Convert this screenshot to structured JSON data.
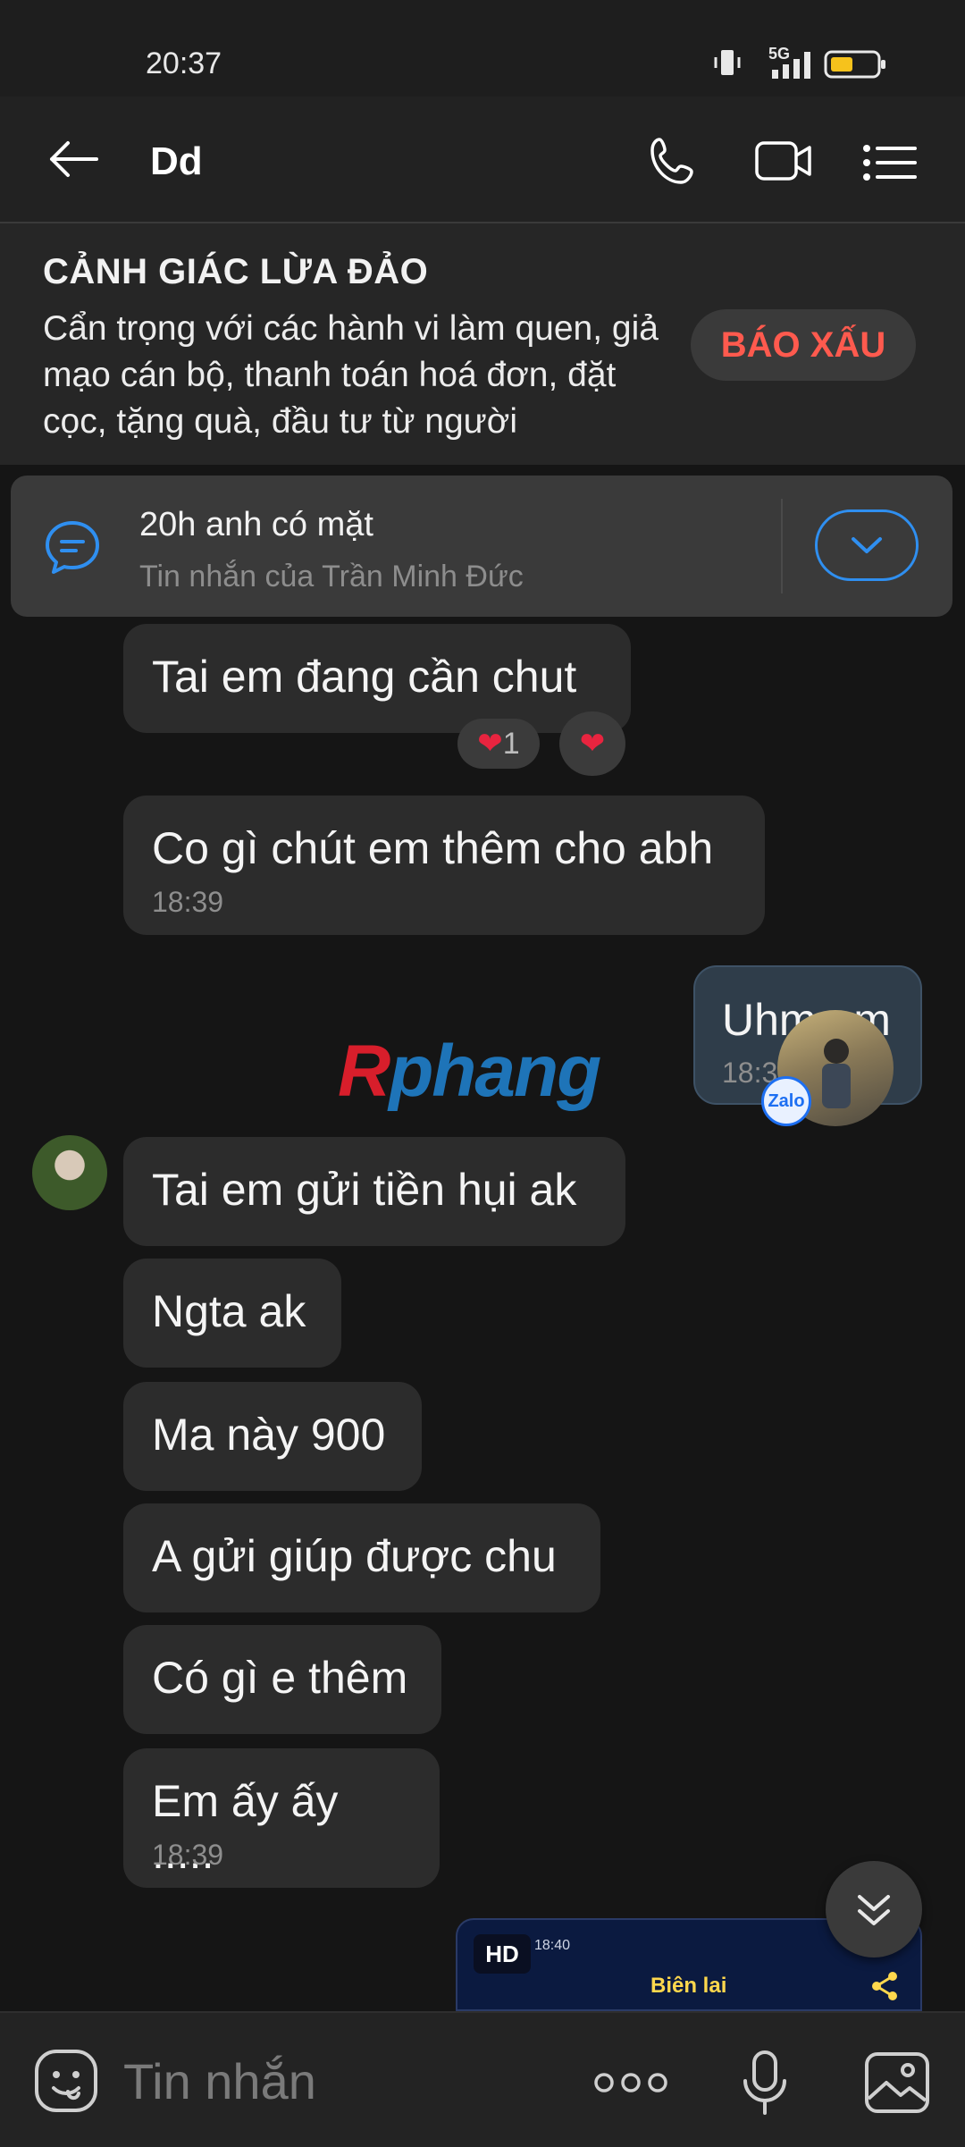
{
  "status_bar": {
    "time": "20:37",
    "network": "5G",
    "icons": [
      "vibrate-icon",
      "signal-icon",
      "battery-icon"
    ]
  },
  "header": {
    "title": "Dd",
    "icons": [
      "back-arrow-icon",
      "phone-icon",
      "video-icon",
      "menu-icon"
    ]
  },
  "warning": {
    "title": "CẢNH GIÁC LỪA ĐẢO",
    "body": "Cẩn trọng với các hành vi làm quen, giả mạo cán bộ, thanh toán hoá đơn, đặt cọc, tặng quà, đầu tư từ người",
    "report_label": "BÁO XẤU"
  },
  "pinned": {
    "title": "20h anh có mặt",
    "subtitle": "Tin nhắn của Trần Minh Đức"
  },
  "messages": [
    {
      "text": "Tai em đang cần chut",
      "reaction_count": "1"
    },
    {
      "text": "Co gì chút em thêm cho abh",
      "time": "18:39"
    },
    {
      "text": "Tai em gửi tiền hụi ak"
    },
    {
      "text": "Ngta ak"
    },
    {
      "text": "Ma này 900"
    },
    {
      "text": "A gửi giúp được chu"
    },
    {
      "text": "Có gì e thêm"
    },
    {
      "text": "Em ấy ấy .....",
      "time": "18:39"
    }
  ],
  "outgoing": {
    "text": "Uhm em",
    "time": "18:3"
  },
  "watermark": {
    "part1": "R",
    "part2": "phang"
  },
  "zalo_badge": "Zalo",
  "screenshot_card": {
    "badge": "HD",
    "time": "18:40",
    "title": "Biên lai"
  },
  "input": {
    "placeholder": "Tin nhắn"
  },
  "colors": {
    "accent_blue": "#2f8ff0",
    "report_red": "#ff5a4e",
    "background": "#151515",
    "bubble": "#2c2c2c"
  }
}
